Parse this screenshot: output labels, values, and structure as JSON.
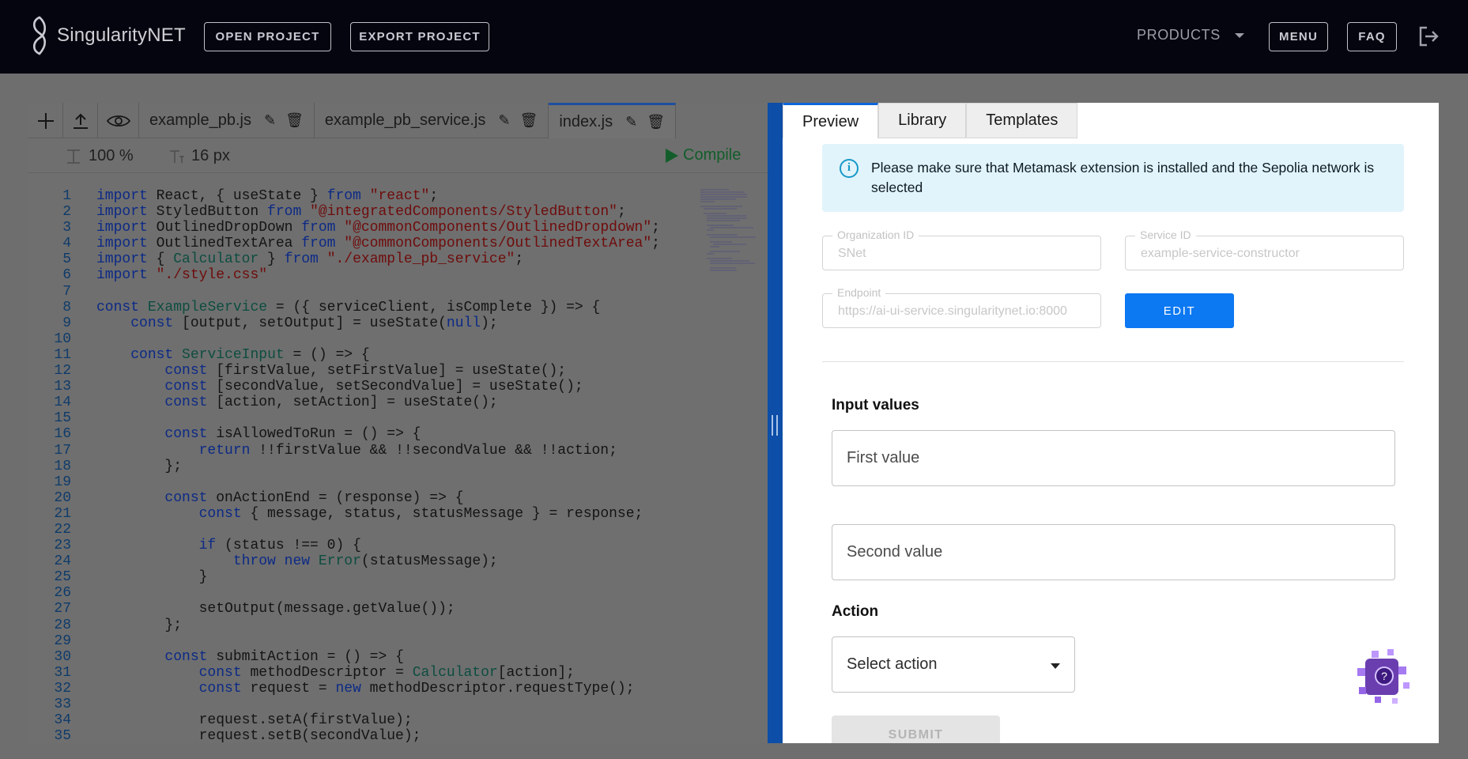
{
  "header": {
    "logo_text": "SingularityNET",
    "open_project": "OPEN PROJECT",
    "export_project": "EXPORT PROJECT",
    "products": "PRODUCTS",
    "menu": "MENU",
    "faq": "FAQ"
  },
  "editor": {
    "tabs": [
      {
        "label": "example_pb.js"
      },
      {
        "label": "example_pb_service.js"
      },
      {
        "label": "index.js"
      }
    ],
    "zoom": "100 %",
    "font_size": "16 px",
    "compile": "Compile",
    "code_lines": [
      "import React, { useState } from \"react\";",
      "import StyledButton from \"@integratedComponents/StyledButton\";",
      "import OutlinedDropDown from \"@commonComponents/OutlinedDropdown\";",
      "import OutlinedTextArea from \"@commonComponents/OutlinedTextArea\";",
      "import { Calculator } from \"./example_pb_service\";",
      "import \"./style.css\"",
      "",
      "const ExampleService = ({ serviceClient, isComplete }) => {",
      "    const [output, setOutput] = useState(null);",
      "",
      "    const ServiceInput = () => {",
      "        const [firstValue, setFirstValue] = useState();",
      "        const [secondValue, setSecondValue] = useState();",
      "        const [action, setAction] = useState();",
      "",
      "        const isAllowedToRun = () => {",
      "            return !!firstValue && !!secondValue && !!action;",
      "        };",
      "",
      "        const onActionEnd = (response) => {",
      "            const { message, status, statusMessage } = response;",
      "",
      "            if (status !== 0) {",
      "                throw new Error(statusMessage);",
      "            }",
      "",
      "            setOutput(message.getValue());",
      "        };",
      "",
      "        const submitAction = () => {",
      "            const methodDescriptor = Calculator[action];",
      "            const request = new methodDescriptor.requestType();",
      "",
      "            request.setA(firstValue);",
      "            request.setB(secondValue);"
    ]
  },
  "preview": {
    "tabs": [
      "Preview",
      "Library",
      "Templates"
    ],
    "info": "Please make sure that Metamask extension is installed and the Sepolia network is selected",
    "org_label": "Organization ID",
    "org_value": "SNet",
    "service_label": "Service ID",
    "service_value": "example-service-constructor",
    "endpoint_label": "Endpoint",
    "endpoint_value": "https://ai-ui-service.singularitynet.io:8000",
    "edit": "EDIT",
    "input_values_title": "Input values",
    "first_value_placeholder": "First value",
    "second_value_placeholder": "Second value",
    "action_title": "Action",
    "select_action": "Select action",
    "submit": "SUBMIT",
    "help_badge": "?"
  },
  "colors": {
    "header_bg": "#05050f",
    "accent_blue": "#0c78f2",
    "splitter": "#0c4ea8",
    "info_bg": "#e1f4fb"
  }
}
